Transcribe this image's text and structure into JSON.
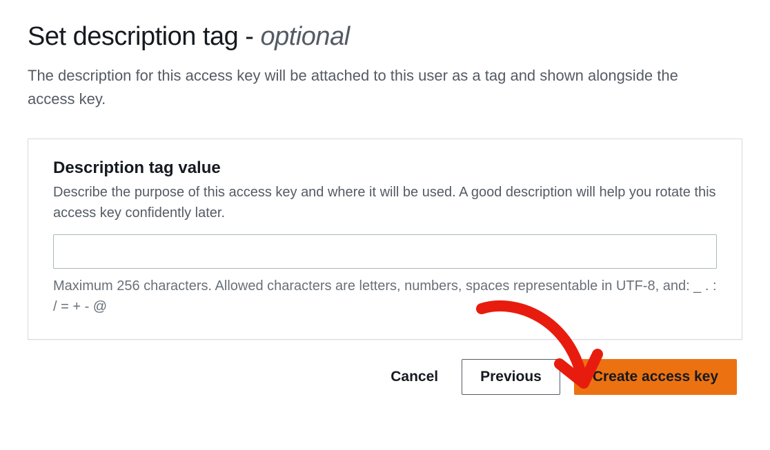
{
  "header": {
    "title_main": "Set description tag",
    "title_separator": " - ",
    "title_optional": "optional",
    "subtitle": "The description for this access key will be attached to this user as a tag and shown alongside the access key."
  },
  "panel": {
    "label": "Description tag value",
    "description": "Describe the purpose of this access key and where it will be used. A good description will help you rotate this access key confidently later.",
    "input_value": "",
    "help_text": "Maximum 256 characters. Allowed characters are letters, numbers, spaces representable in UTF-8, and: _ . : / = + - @"
  },
  "buttons": {
    "cancel": "Cancel",
    "previous": "Previous",
    "create": "Create access key"
  },
  "colors": {
    "primary_bg": "#ec7211",
    "text_primary": "#16191f",
    "text_secondary": "#545b64",
    "border": "#d5dbdb",
    "annotation_arrow": "#e81c0e"
  }
}
